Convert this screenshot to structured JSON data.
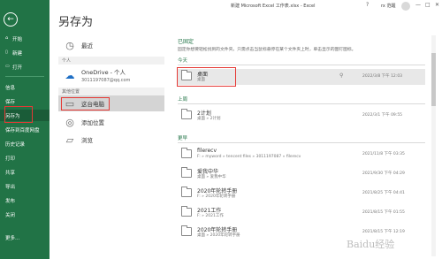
{
  "window": {
    "title": "新建 Microsoft Excel 工作表.xlsx - Excel",
    "user": "rx 范醒",
    "controls": [
      "?",
      "—",
      "□",
      "✕"
    ]
  },
  "page": {
    "title": "另存为"
  },
  "sidebar": {
    "back": "←",
    "items": [
      {
        "label": "开始",
        "icon": "home-icon"
      },
      {
        "label": "新建",
        "icon": "new-icon"
      },
      {
        "label": "打开",
        "icon": "open-icon"
      },
      {
        "label": "信息",
        "icon": ""
      },
      {
        "label": "保存",
        "icon": ""
      },
      {
        "label": "另存为",
        "icon": ""
      },
      {
        "label": "保存到百度网盘",
        "icon": ""
      },
      {
        "label": "历史记录",
        "icon": ""
      },
      {
        "label": "打印",
        "icon": ""
      },
      {
        "label": "共享",
        "icon": ""
      },
      {
        "label": "导出",
        "icon": ""
      },
      {
        "label": "发布",
        "icon": ""
      },
      {
        "label": "关闭",
        "icon": ""
      },
      {
        "label": "更多...",
        "icon": ""
      }
    ]
  },
  "locations": {
    "recent": "最近",
    "personal_heading": "个人",
    "onedrive_label": "OneDrive - 个人",
    "onedrive_account": "3011197087@qq.com",
    "other_heading": "其他位置",
    "this_pc": "这台电脑",
    "add_location": "添加位置",
    "browse": "浏览"
  },
  "files": {
    "pinned_title": "已固定",
    "pinned_desc": "固定你想要轻松找到的文件夹。只需点击当鼠标悬停在某个文件夹上时，单击显示的图钉图标。",
    "sections": [
      {
        "heading": "今天",
        "rows": [
          {
            "name": "桌面",
            "path": "桌面",
            "date": "2022/3/8 下午 12:03",
            "pinned": true
          }
        ]
      },
      {
        "heading": "上周",
        "rows": [
          {
            "name": "2计划",
            "path": "桌面 » 2计划",
            "date": "2022/3/1 下午 09:55",
            "pinned": false
          }
        ]
      },
      {
        "heading": "更早",
        "rows": [
          {
            "name": "filerecv",
            "path": "F: » myword » tencent files » 3011197087 » filerecv",
            "date": "2021/11/8 下午 03:35",
            "pinned": false
          },
          {
            "name": "爱我中华",
            "path": "桌面 » 爱我中华",
            "date": "2021/9/30 下午 04:29",
            "pinned": false
          },
          {
            "name": "2020年轮转手册",
            "path": "F: » 2020年轮转手册",
            "date": "2021/8/25 下午 04:41",
            "pinned": false
          },
          {
            "name": "2021工作",
            "path": "F: » 2021工作",
            "date": "2021/8/15 下午 01:55",
            "pinned": false
          },
          {
            "name": "2020年轮转手册",
            "path": "桌面 » 2020年轮转手册",
            "date": "2021/8/15 下午 12:19",
            "pinned": false
          }
        ]
      }
    ]
  },
  "watermark": "Baidu经验"
}
